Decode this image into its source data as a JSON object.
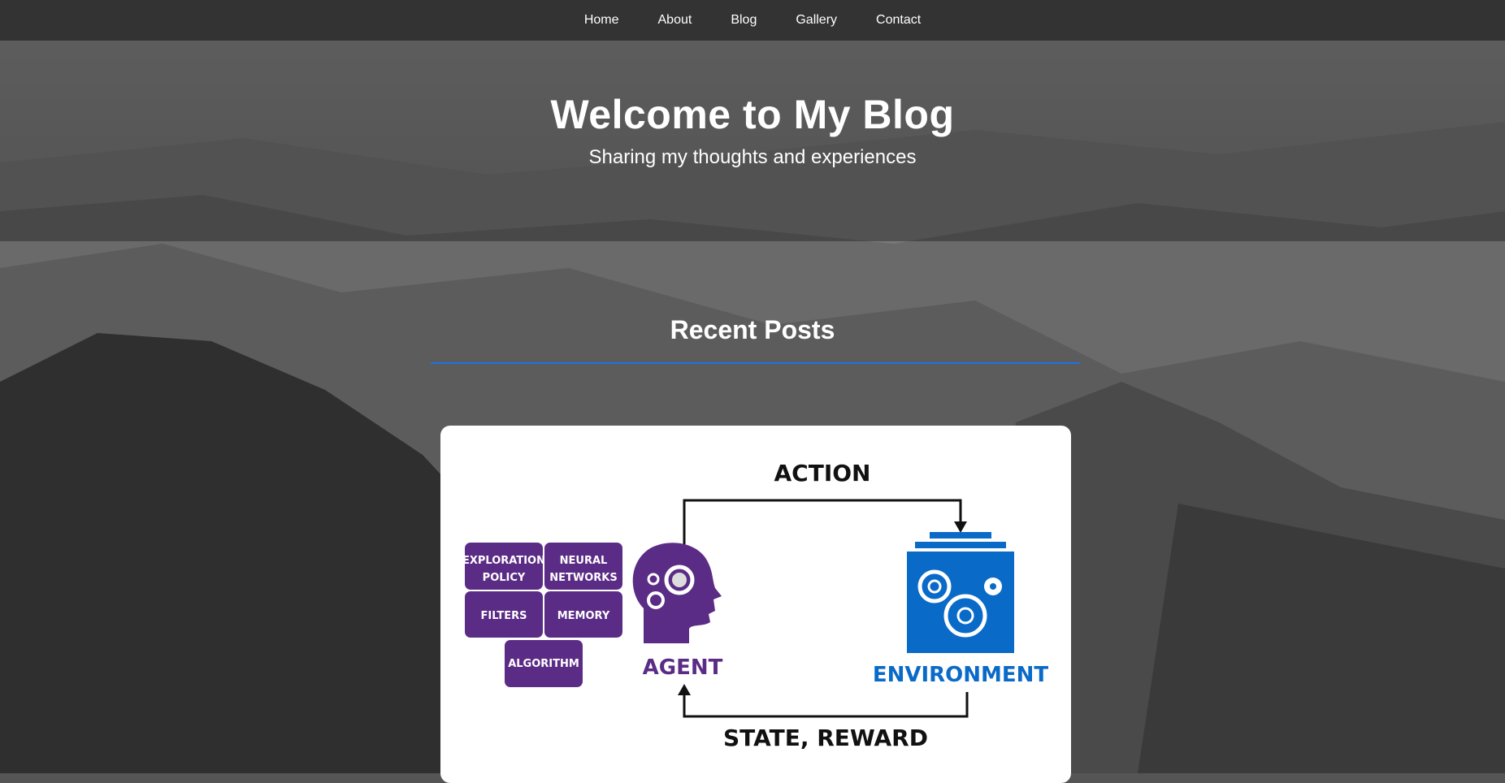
{
  "nav": {
    "items": [
      {
        "label": "Home"
      },
      {
        "label": "About"
      },
      {
        "label": "Blog"
      },
      {
        "label": "Gallery"
      },
      {
        "label": "Contact"
      }
    ]
  },
  "hero": {
    "title": "Welcome to My Blog",
    "subtitle": "Sharing my thoughts and experiences"
  },
  "recent": {
    "heading": "Recent Posts",
    "accent_color": "#1a73e8"
  },
  "post_image": {
    "action_label": "ACTION",
    "state_reward_label": "STATE, REWARD",
    "agent_label": "AGENT",
    "environment_label": "ENVIRONMENT",
    "blocks": {
      "exploration_line1": "EXPLORATION",
      "exploration_line2": "POLICY",
      "neural_line1": "NEURAL",
      "neural_line2": "NETWORKS",
      "filters": "FILTERS",
      "memory": "MEMORY",
      "algorithm": "ALGORITHM"
    },
    "colors": {
      "agent": "#5b2c86",
      "environment": "#0a6ac8"
    }
  }
}
